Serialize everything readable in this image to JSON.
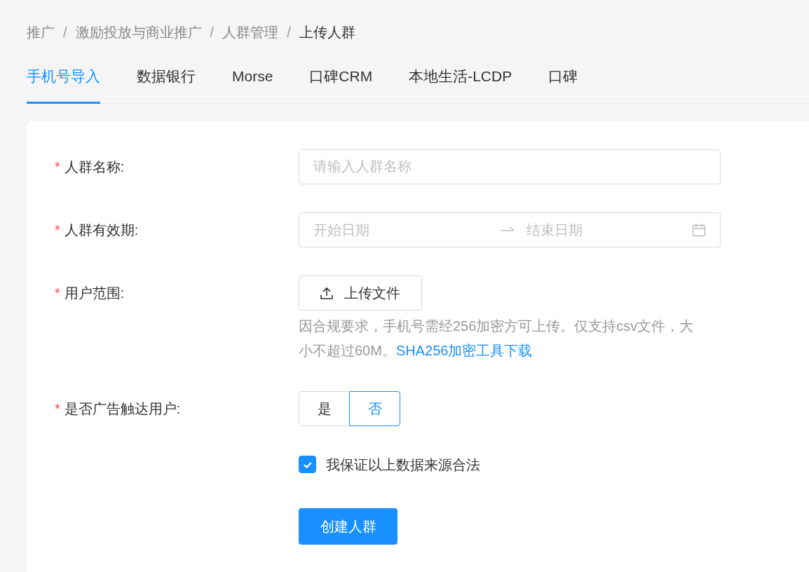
{
  "breadcrumb": [
    "推广",
    "激励投放与商业推广",
    "人群管理",
    "上传人群"
  ],
  "breadcrumb_separator": "/",
  "tabs": [
    {
      "label": "手机号导入",
      "selected": true
    },
    {
      "label": "数据银行",
      "selected": false
    },
    {
      "label": "Morse",
      "selected": false
    },
    {
      "label": "口碑CRM",
      "selected": false
    },
    {
      "label": "本地生活-LCDP",
      "selected": false
    },
    {
      "label": "口碑",
      "selected": false
    }
  ],
  "form": {
    "fields": [
      {
        "kind": "input",
        "label": "人群名称:",
        "required": true,
        "placeholder": "请输入人群名称"
      },
      {
        "kind": "date_range",
        "label": "人群有效期:",
        "required": true,
        "start_placeholder": "开始日期",
        "end_placeholder": "结束日期"
      },
      {
        "kind": "upload",
        "label": "用户范围:",
        "required": true,
        "button": "上传文件",
        "help": "因合规要求，手机号需经256加密方可上传。仅支持csv文件，大小不超过60M。",
        "link": "SHA256加密工具下载"
      },
      {
        "kind": "radio",
        "label": "是否广告触达用户:",
        "required": true,
        "options": [
          {
            "label": "是",
            "selected": false
          },
          {
            "label": "否",
            "selected": true
          }
        ]
      }
    ],
    "required_mark": "*",
    "agreement": {
      "label": "我保证以上数据来源合法",
      "checked": true
    },
    "submit": "创建人群"
  }
}
